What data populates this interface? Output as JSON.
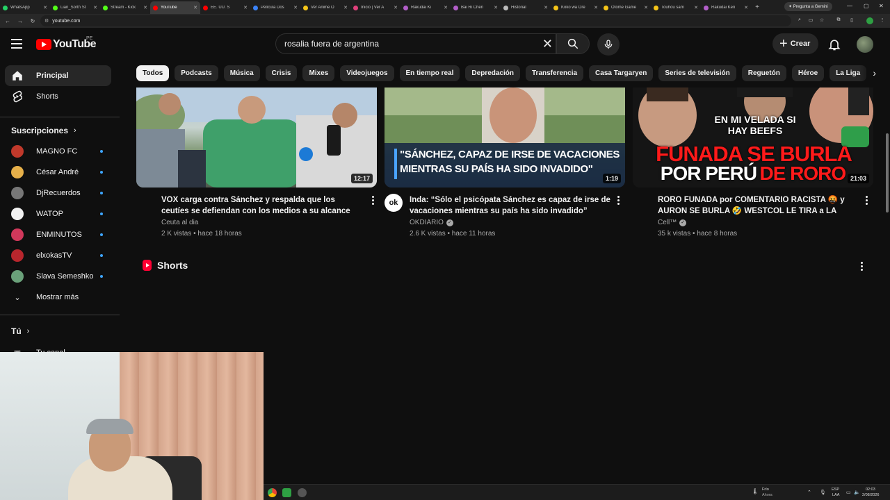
{
  "browser": {
    "tabs": [
      {
        "label": "WhatsApp",
        "color": "#25d366"
      },
      {
        "label": "Lian_Sorth St",
        "color": "#53fc18"
      },
      {
        "label": "Stream - Kick",
        "color": "#53fc18"
      },
      {
        "label": "YouTube",
        "color": "#ff0000",
        "active": true
      },
      {
        "label": "EE. UU. S",
        "color": "#ff0000"
      },
      {
        "label": "Película Dos",
        "color": "#3b82f6"
      },
      {
        "label": "Ver Anime O",
        "color": "#f5c518"
      },
      {
        "label": "Inicio | Ver A",
        "color": "#e0407b"
      },
      {
        "label": "Rakudai Ki",
        "color": "#b25ec9"
      },
      {
        "label": "Bai Ri Chen",
        "color": "#b25ec9"
      },
      {
        "label": "Historial",
        "color": "#bbbbbb"
      },
      {
        "label": "Koko wa Ore",
        "color": "#f5c518"
      },
      {
        "label": "Otome Game",
        "color": "#f5c518"
      },
      {
        "label": "Touhou sam",
        "color": "#f5c518"
      },
      {
        "label": "Rakudai Ken",
        "color": "#b25ec9"
      }
    ],
    "gemini_label": "Pregunta a Gemini",
    "url": "youtube.com"
  },
  "youtube": {
    "logo_text": "YouTube",
    "country_code": "PE",
    "search_value": "rosalia fuera de argentina",
    "create_label": "Crear"
  },
  "sidebar": {
    "main": [
      {
        "label": "Principal",
        "icon": "home-icon",
        "active": true
      },
      {
        "label": "Shorts",
        "icon": "shorts-icon"
      }
    ],
    "subscriptions_title": "Suscripciones",
    "subscriptions": [
      {
        "label": "MAGNO FC",
        "color": "#c0392b"
      },
      {
        "label": "César André",
        "color": "#e6b04a"
      },
      {
        "label": "DjRecuerdos",
        "color": "#777777"
      },
      {
        "label": "WATOP",
        "color": "#f1f1f1"
      },
      {
        "label": "ENMINUTOS",
        "color": "#d1385b"
      },
      {
        "label": "elxokasTV",
        "color": "#b8262d"
      },
      {
        "label": "Slava Semeshko",
        "color": "#6aa17a"
      }
    ],
    "show_more_label": "Mostrar más",
    "you_title": "Tú",
    "your_channel_label": "Tu canal"
  },
  "chips": [
    "Todos",
    "Podcasts",
    "Música",
    "Crisis",
    "Mixes",
    "Videojuegos",
    "En tiempo real",
    "Depredación",
    "Transferencia",
    "Casa Targaryen",
    "Series de televisión",
    "Reguetón",
    "Héroe",
    "La Liga"
  ],
  "videos": [
    {
      "title": "VOX carga contra Sánchez y respalda que los ceutíes se defiendan con los medios a su alcance",
      "channel": "Ceuta al dia",
      "verified": false,
      "views": "2 K vistas",
      "age": "hace 18 horas",
      "duration": "12:17"
    },
    {
      "title": "Inda: “Sólo el psicópata Sánchez es capaz de irse de vacaciones mientras su país ha sido invadido”",
      "channel": "OKDIARIO",
      "verified": true,
      "views": "2.6 K vistas",
      "age": "hace 11 horas",
      "duration": "1:19",
      "avatar_text": "ok",
      "thumb_caption": "\"SÁNCHEZ, CAPAZ DE IRSE DE VACACIONES MIENTRAS SU PAÍS HA SIDO INVADIDO\""
    },
    {
      "title": "RORO FUNADA por COMENTARIO RACISTA 🤬 y AURON SE BURLA 🤣 WESTCOL LE TIRA a LA VELAD...",
      "channel": "Cell™",
      "verified": true,
      "views": "35 k vistas",
      "age": "hace 8 horas",
      "duration": "21:03",
      "thumb_top": "EN MI VELADA SI HAY BEEFS",
      "thumb_red": "FUNADA SE BURLA",
      "thumb_white_1": "POR PERÚ",
      "thumb_white_2": "DE RORO"
    }
  ],
  "shorts_title": "Shorts",
  "taskbar": {
    "weather_label": "Frío",
    "weather_sub": "Ahora",
    "lang": "ESP",
    "lang_sub": "LAA",
    "time": "02:03",
    "date": "2/08/2026"
  }
}
